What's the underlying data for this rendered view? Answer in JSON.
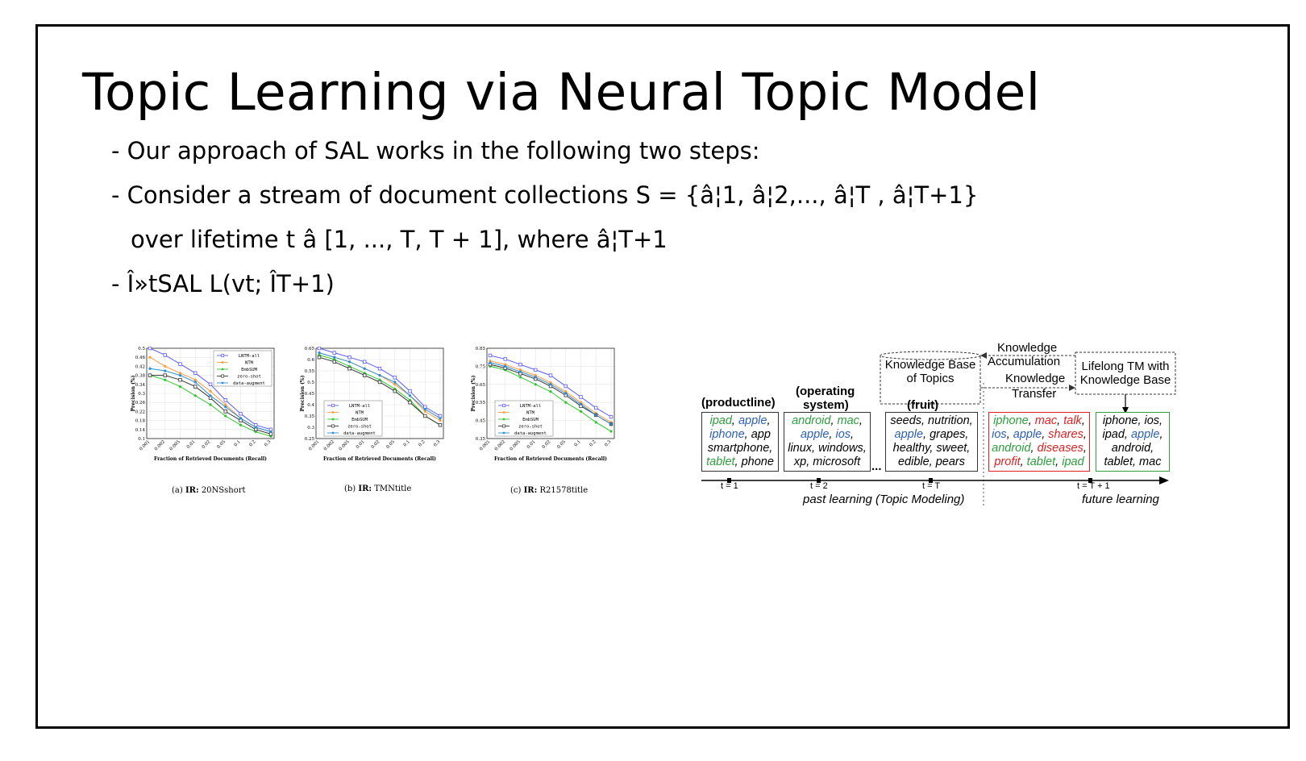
{
  "slide": {
    "title": "Topic Learning via Neural Topic Model",
    "bullets": [
      "- Our approach of SAL works in the following two steps:",
      "- Consider a stream of document collections S = {â\u001f¦1, â\u001f¦2,..., â\u001f¦T , â\u001f¦T+1}",
      "over lifetime t â\u001f\u001f [1, ..., T, T + 1], where â\u001f¦T+1",
      "- Î»tSAL L(vt; Î\u001fT+1)"
    ]
  },
  "chart_data": [
    {
      "type": "line",
      "caption_prefix": "(a) ",
      "caption_bold": "IR:",
      "caption_rest": " 20NSshort",
      "xlabel": "Fraction of Retrieved Documents (Recall)",
      "ylabel": "Precision (%)",
      "categories": [
        "0.001",
        "0.002",
        "0.005",
        "0.01",
        "0.02",
        "0.05",
        "0.1",
        "0.2",
        "0.3"
      ],
      "yticks": [
        "0.1",
        "0.14",
        "0.18",
        "0.22",
        "0.26",
        "0.3",
        "0.34",
        "0.38",
        "0.42",
        "0.46",
        "0.5"
      ],
      "ylim": [
        0.1,
        0.5
      ],
      "legend_position": "top-right",
      "series": [
        {
          "name": "LNTM-all",
          "color": "#5a5aff",
          "marker": "square-open",
          "values": [
            0.5,
            0.47,
            0.43,
            0.39,
            0.34,
            0.27,
            0.21,
            0.16,
            0.14
          ]
        },
        {
          "name": "NTM",
          "color": "#ff9a3c",
          "marker": "dot",
          "values": [
            0.46,
            0.42,
            0.39,
            0.36,
            0.31,
            0.25,
            0.19,
            0.15,
            0.13
          ]
        },
        {
          "name": "EmbSUM",
          "color": "#2ec82e",
          "marker": "dot",
          "values": [
            0.38,
            0.36,
            0.33,
            0.29,
            0.25,
            0.2,
            0.16,
            0.13,
            0.11
          ]
        },
        {
          "name": "zero-shot",
          "color": "#333333",
          "marker": "square-open",
          "values": [
            0.38,
            0.38,
            0.36,
            0.33,
            0.28,
            0.22,
            0.18,
            0.14,
            0.12
          ]
        },
        {
          "name": "data-augment",
          "color": "#2a8fd6",
          "marker": "dot",
          "values": [
            0.41,
            0.4,
            0.38,
            0.35,
            0.29,
            0.24,
            0.19,
            0.15,
            0.13
          ]
        }
      ]
    },
    {
      "type": "line",
      "caption_prefix": "(b) ",
      "caption_bold": "IR:",
      "caption_rest": " TMNtitle",
      "xlabel": "Fraction of Retrieved Documents (Recall)",
      "ylabel": "Precision (%)",
      "categories": [
        "0.001",
        "0.002",
        "0.005",
        "0.01",
        "0.02",
        "0.05",
        "0.1",
        "0.2",
        "0.3"
      ],
      "yticks": [
        "0.25",
        "0.3",
        "0.35",
        "0.4",
        "0.45",
        "0.5",
        "0.55",
        "0.6",
        "0.65"
      ],
      "ylim": [
        0.25,
        0.65
      ],
      "legend_position": "bottom-left",
      "series": [
        {
          "name": "LNTM-all",
          "color": "#5a5aff",
          "marker": "square-open",
          "values": [
            0.65,
            0.63,
            0.61,
            0.59,
            0.56,
            0.52,
            0.46,
            0.39,
            0.35
          ]
        },
        {
          "name": "NTM",
          "color": "#ff9a3c",
          "marker": "dot",
          "values": [
            0.63,
            0.61,
            0.59,
            0.56,
            0.53,
            0.49,
            0.44,
            0.37,
            0.33
          ]
        },
        {
          "name": "EmbSUM",
          "color": "#2ec82e",
          "marker": "dot",
          "values": [
            0.62,
            0.6,
            0.57,
            0.54,
            0.51,
            0.47,
            0.42,
            0.35,
            0.31
          ]
        },
        {
          "name": "zero-shot",
          "color": "#333333",
          "marker": "square-open",
          "values": [
            0.61,
            0.59,
            0.56,
            0.53,
            0.5,
            0.46,
            0.41,
            0.35,
            0.31
          ]
        },
        {
          "name": "data-augment",
          "color": "#2a8fd6",
          "marker": "dot",
          "values": [
            0.63,
            0.61,
            0.59,
            0.56,
            0.53,
            0.5,
            0.44,
            0.38,
            0.34
          ]
        }
      ]
    },
    {
      "type": "line",
      "caption_prefix": "(c) ",
      "caption_bold": "IR:",
      "caption_rest": " R21578title",
      "xlabel": "Fraction of Retrieved Documents (Recall)",
      "ylabel": "Precision (%)",
      "categories": [
        "0.001",
        "0.002",
        "0.005",
        "0.01",
        "0.02",
        "0.05",
        "0.1",
        "0.2",
        "0.3"
      ],
      "yticks": [
        "0.35",
        "0.45",
        "0.55",
        "0.65",
        "0.75",
        "0.85"
      ],
      "ylim": [
        0.35,
        0.85
      ],
      "legend_position": "bottom-left",
      "series": [
        {
          "name": "LNTM-all",
          "color": "#5a5aff",
          "marker": "square-open",
          "values": [
            0.81,
            0.79,
            0.76,
            0.73,
            0.7,
            0.64,
            0.58,
            0.52,
            0.47
          ]
        },
        {
          "name": "NTM",
          "color": "#ff9a3c",
          "marker": "dot",
          "values": [
            0.78,
            0.76,
            0.73,
            0.7,
            0.66,
            0.61,
            0.55,
            0.49,
            0.44
          ]
        },
        {
          "name": "EmbSUM",
          "color": "#2ec82e",
          "marker": "dot",
          "values": [
            0.75,
            0.73,
            0.69,
            0.65,
            0.61,
            0.55,
            0.5,
            0.44,
            0.39
          ]
        },
        {
          "name": "zero-shot",
          "color": "#333333",
          "marker": "square-open",
          "values": [
            0.76,
            0.74,
            0.71,
            0.68,
            0.64,
            0.59,
            0.53,
            0.48,
            0.43
          ]
        },
        {
          "name": "data-augment",
          "color": "#2a8fd6",
          "marker": "dot",
          "values": [
            0.77,
            0.75,
            0.72,
            0.69,
            0.65,
            0.6,
            0.54,
            0.48,
            0.43
          ]
        }
      ]
    }
  ],
  "diagram": {
    "kb_label": [
      "Knowledge Base",
      "of Topics"
    ],
    "lifelong_label": [
      "Lifelong TM with",
      "Knowledge Base"
    ],
    "accumulation_label": [
      "Knowledge",
      "Accumulation"
    ],
    "transfer_label": [
      "Knowledge",
      "Transfer"
    ],
    "headers": [
      "(productline)",
      "(operating",
      "system)",
      "(fruit)"
    ],
    "ellipsis": "...",
    "boxes": [
      {
        "lines": [
          [
            {
              "t": "ipad",
              "c": "green"
            },
            {
              "t": ", ",
              "c": "black"
            },
            {
              "t": "apple",
              "c": "blue"
            },
            {
              "t": ",",
              "c": "black"
            }
          ],
          [
            {
              "t": "iphone",
              "c": "blue"
            },
            {
              "t": ", app",
              "c": "black"
            }
          ],
          [
            {
              "t": "smartphone,",
              "c": "black"
            }
          ],
          [
            {
              "t": "tablet",
              "c": "green"
            },
            {
              "t": ", phone",
              "c": "black"
            }
          ]
        ]
      },
      {
        "lines": [
          [
            {
              "t": "android",
              "c": "green"
            },
            {
              "t": ", ",
              "c": "black"
            },
            {
              "t": "mac",
              "c": "green"
            },
            {
              "t": ",",
              "c": "black"
            }
          ],
          [
            {
              "t": "apple",
              "c": "blue"
            },
            {
              "t": ", ",
              "c": "black"
            },
            {
              "t": "ios",
              "c": "blue"
            },
            {
              "t": ",",
              "c": "black"
            }
          ],
          [
            {
              "t": "linux, windows,",
              "c": "black"
            }
          ],
          [
            {
              "t": "xp, microsoft",
              "c": "black"
            }
          ]
        ]
      },
      {
        "lines": [
          [
            {
              "t": "seeds, nutrition,",
              "c": "black"
            }
          ],
          [
            {
              "t": "apple",
              "c": "blue"
            },
            {
              "t": ", grapes,",
              "c": "black"
            }
          ],
          [
            {
              "t": "healthy, sweet,",
              "c": "black"
            }
          ],
          [
            {
              "t": "edible, pears",
              "c": "black"
            }
          ]
        ]
      },
      {
        "lines": [
          [
            {
              "t": "iphone",
              "c": "green"
            },
            {
              "t": ", ",
              "c": "black"
            },
            {
              "t": "mac",
              "c": "red"
            },
            {
              "t": ", ",
              "c": "black"
            },
            {
              "t": "talk",
              "c": "red"
            },
            {
              "t": ",",
              "c": "black"
            }
          ],
          [
            {
              "t": "ios",
              "c": "blue"
            },
            {
              "t": ", ",
              "c": "black"
            },
            {
              "t": "apple",
              "c": "blue"
            },
            {
              "t": ", ",
              "c": "black"
            },
            {
              "t": "shares",
              "c": "red"
            },
            {
              "t": ",",
              "c": "black"
            }
          ],
          [
            {
              "t": "android",
              "c": "green"
            },
            {
              "t": ", ",
              "c": "black"
            },
            {
              "t": "diseases",
              "c": "red"
            },
            {
              "t": ",",
              "c": "black"
            }
          ],
          [
            {
              "t": "profit",
              "c": "red"
            },
            {
              "t": ", ",
              "c": "black"
            },
            {
              "t": "tablet",
              "c": "green"
            },
            {
              "t": ", ",
              "c": "black"
            },
            {
              "t": "ipad",
              "c": "green"
            }
          ]
        ]
      },
      {
        "lines": [
          [
            {
              "t": "iphone, ios,",
              "c": "black"
            }
          ],
          [
            {
              "t": "ipad, ",
              "c": "black"
            },
            {
              "t": "apple",
              "c": "blue"
            },
            {
              "t": ",",
              "c": "black"
            }
          ],
          [
            {
              "t": "android,",
              "c": "black"
            }
          ],
          [
            {
              "t": "tablet, mac",
              "c": "black"
            }
          ]
        ]
      }
    ],
    "timeline_ticks": [
      "t = 1",
      "t = 2",
      "t = T",
      "t = T + 1"
    ],
    "past_label": "past learning (Topic Modeling)",
    "future_label": "future learning",
    "colors": {
      "green": "#2e9e3e",
      "blue": "#2c5fb3",
      "red": "#e02020",
      "black": "#000000"
    }
  }
}
